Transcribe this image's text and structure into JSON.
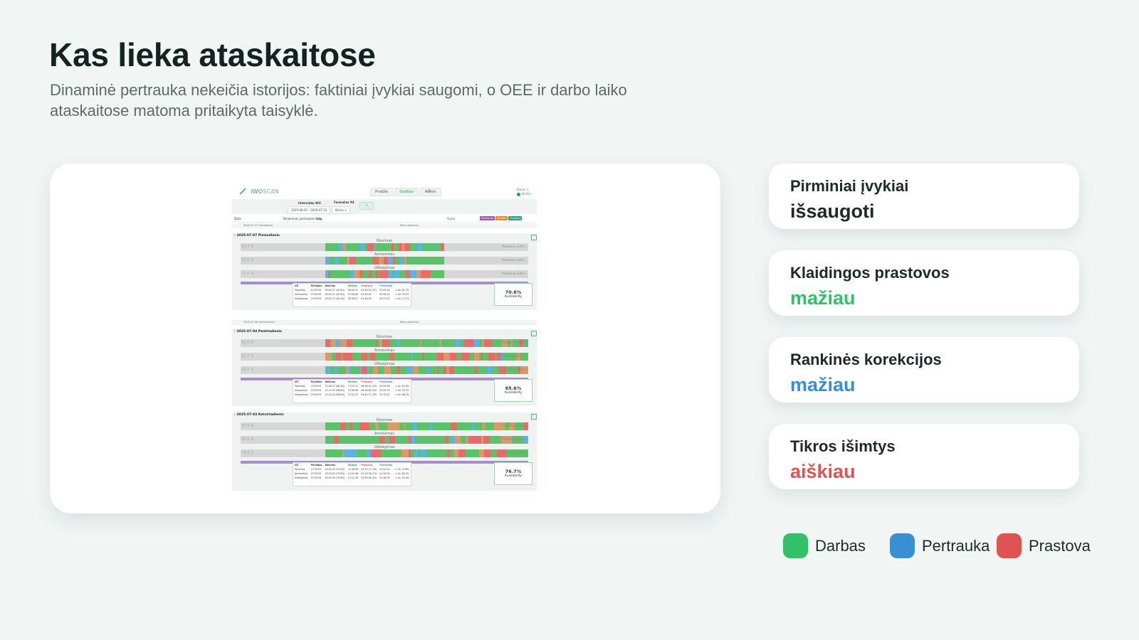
{
  "slide": {
    "title": "Kas lieka ataskaitose",
    "subtitle": "Dinaminė pertrauka nekeičia istorijos: faktiniai įvykiai saugomi, o OEE ir darbo laiko ataskaitose matoma pritaikyta taisyklė."
  },
  "colors": {
    "work": "#34c06b",
    "break": "#3a8fd3",
    "downtime": "#e05353",
    "bg": "#f1f6f5"
  },
  "metrics": [
    {
      "label": "Pirminiai įvykiai",
      "value": "išsaugoti",
      "color": "#1d2b28"
    },
    {
      "label": "Klaidingos prastovos",
      "value": "mažiau",
      "color": "#34c06b"
    },
    {
      "label": "Rankinės korekcijos",
      "value": "mažiau",
      "color": "#3a8fd3"
    },
    {
      "label": "Tikros išimtys",
      "value": "aiškiau",
      "color": "#e05353"
    }
  ],
  "legend": [
    {
      "label": "Darbas",
      "color": "#34c06b"
    },
    {
      "label": "Pertrauka",
      "color": "#3a8fd3"
    },
    {
      "label": "Prastova",
      "color": "#e05353"
    }
  ],
  "screenshot": {
    "logo_prefix": "IWO",
    "logo_suffix": "SCAN",
    "nav": [
      "Pradžia",
      "Grafikai",
      "Admin"
    ],
    "user": {
      "name": "Biuras 1",
      "status": "Online"
    },
    "filters": {
      "interval_label": "Intervalas Kiti",
      "interval_value": "2025-06-01 - 2025-07-31",
      "format_label": "Formatas #4",
      "format_value": "Diena ↓",
      "search_icon": "⌕",
      "sum_label": "Suma"
    },
    "header": {
      "date_col": "Data",
      "dynamic_col": "Dinaminės pertraukos",
      "dynamic_val": "taip"
    },
    "tags": [
      "Pertrauka",
      "Sutrikai",
      "Prastova"
    ],
    "days": [
      {
        "summary_date": "2025-07-07 Antradienis",
        "summary_note": "Nėra duomenų",
        "title": "2025-07-07 Pirmadienis",
        "lanes": [
          {
            "name": "Pjovimas",
            "pct": "60.7 %",
            "prastova": "Prastova 120 s."
          },
          {
            "name": "Armavimas",
            "pct": "58.0 %",
            "prastova": "Prastova 420 s."
          },
          {
            "name": "Užbaigimas",
            "pct": "71.1 %",
            "prastova": "Prastova 330 s."
          }
        ],
        "stats_head": [
          "UŽ",
          "Periodas",
          "Aktyvus",
          "Darbas",
          "Prastova",
          "Pertrauka",
          ""
        ],
        "stats_rows": [
          [
            "Pjovimas",
            "23:59:59",
            "09:44:27 (40.6%)",
            "08:00:21",
            "02:44:05 (27)",
            "01:00:00",
            "✔ Av. 82.7%"
          ],
          [
            "Armavimas",
            "23:59:59",
            "09:44:27 (40.6%)",
            "07:28:06",
            "01:09:06",
            "00:58:15",
            "✔ Av. 76.2%"
          ],
          [
            "Užbaigimas",
            "23:59:59",
            "09:41:12 (40.4%)",
            "08:36:21",
            "01:44:50",
            "00:57:52",
            "✔ Av. 71.1%"
          ]
        ],
        "availability": "70.6%",
        "availability_label": "Availability"
      },
      {
        "summary_date": "2025-07-06 Sekmadienis",
        "summary_note": "Nėra duomenų",
        "title": "2025-07-04 Penktadienis",
        "lanes": [
          {
            "name": "Pjovimas",
            "pct": "61.5 %",
            "prastova": "Prastova 120 s."
          },
          {
            "name": "Armavimas",
            "pct": "62.7 %",
            "prastova": "Prastova 420 s."
          },
          {
            "name": "Užbaigimas",
            "pct": "68.2 %",
            "prastova": "Prastova 330 s."
          }
        ],
        "stats_head": [
          "UŽ",
          "Periodas",
          "Aktyvus",
          "Darbas",
          "Prastova",
          "Pertrauka",
          ""
        ],
        "stats_rows": [
          [
            "Pjovimas",
            "23:59:59",
            "22:08:27 (98.4%)",
            "13:53:11",
            "06:56:15 (20)",
            "02:00:06",
            "✔ Av. 67.8%"
          ],
          [
            "Armavimas",
            "23:59:59",
            "22:14:32 (98.8%)",
            "15:36:38",
            "04:18:46 (23)",
            "02:25:15",
            "✔ Av. 79.7%"
          ],
          [
            "Užbaigimas",
            "23:59:59",
            "22:14:12 (98.8%)",
            "15:21:25",
            "04:42:17 (29)",
            "02:10:47",
            "✔ Av. 68.2%"
          ]
        ],
        "availability": "65.6%",
        "availability_label": "Availability"
      },
      {
        "title": "2025-07-03 Ketvirtadienis",
        "lanes": [
          {
            "name": "Pjovimas",
            "pct": "70.8 %",
            "prastova": "Prastova 120 s."
          },
          {
            "name": "Armavimas",
            "pct": "80.0 %",
            "prastova": "Prastova 420 s."
          },
          {
            "name": "Užbaigimas",
            "pct": "78.4 %",
            "prastova": "Prastova 330 s."
          }
        ],
        "stats_head": [
          "UŽ",
          "Periodas",
          "Aktyvus",
          "Darbas",
          "Prastova",
          "Pertrauka",
          ""
        ],
        "stats_rows": [
          [
            "Pjovimas",
            "23:59:59",
            "16:50:00 (70.6%)",
            "11:49:56",
            "03:57:17 (39)",
            "01:02:15",
            "✔ Av. 70.8%"
          ],
          [
            "Armavimas",
            "23:59:59",
            "16:50:05 (70.6%)",
            "13:02:48",
            "02:16:38 (13)",
            "01:28:00",
            "✔ Av. 80.0%"
          ],
          [
            "Užbaigimas",
            "23:59:59",
            "16:54:30 (70.6%)",
            "12:11:16",
            "01:50:08 (15)",
            "01:48:35",
            "✔ Av. 78.4%"
          ]
        ],
        "availability": "76.7%",
        "availability_label": "Availability"
      }
    ]
  }
}
